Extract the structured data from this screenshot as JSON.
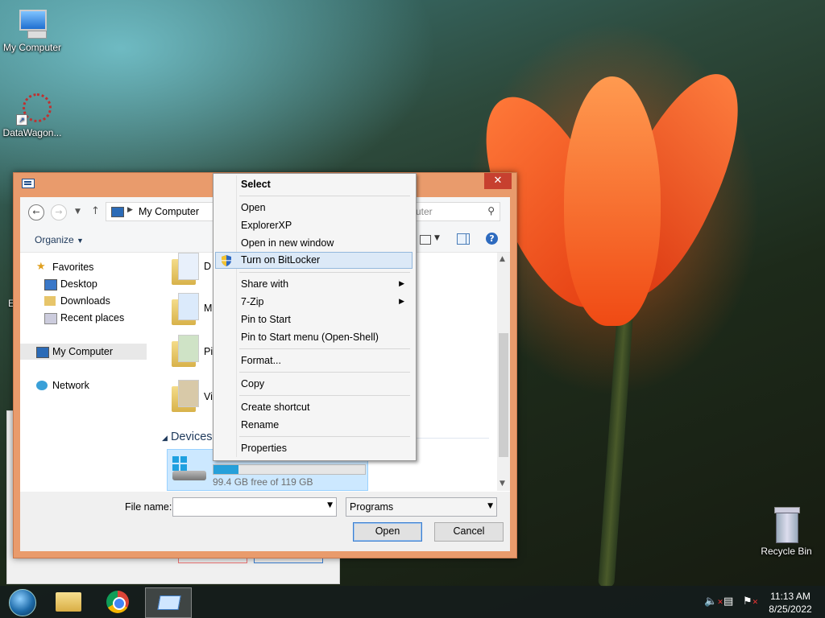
{
  "desktop": {
    "icons": [
      {
        "label": "My Computer"
      },
      {
        "label": "DataWagon..."
      },
      {
        "label": "Recycle Bin"
      }
    ],
    "edge_letter": "E"
  },
  "dialog": {
    "address": {
      "location": "My Computer"
    },
    "search": {
      "placeholder": "uter"
    },
    "toolbar": {
      "organize": "Organize"
    },
    "nav": {
      "favorites": "Favorites",
      "desktop": "Desktop",
      "downloads": "Downloads",
      "recent": "Recent places",
      "my_computer": "My Computer",
      "network": "Network"
    },
    "folders": [
      {
        "label": "D"
      },
      {
        "label": "M"
      },
      {
        "label": "Pi"
      },
      {
        "label": "Vi"
      }
    ],
    "devices_header": "Devices a",
    "drive": {
      "label": "Lo",
      "free_text": "99.4 GB free of 119 GB",
      "used_fraction": 0.165
    },
    "file_name_label": "File name:",
    "file_name_value": "",
    "file_type": "Programs",
    "open_label": "Open",
    "cancel_label": "Cancel"
  },
  "context_menu": {
    "header": "Select",
    "items": [
      {
        "label": "Open"
      },
      {
        "label": "ExplorerXP"
      },
      {
        "label": "Open in new window"
      },
      {
        "label": "Turn on BitLocker",
        "highlighted": true
      },
      {
        "label": "Share with",
        "submenu": true
      },
      {
        "label": "7-Zip",
        "submenu": true
      },
      {
        "label": "Pin to Start"
      },
      {
        "label": "Pin to Start menu (Open-Shell)"
      },
      {
        "label": "Format..."
      },
      {
        "label": "Copy"
      },
      {
        "label": "Create shortcut"
      },
      {
        "label": "Rename"
      },
      {
        "label": "Properties"
      }
    ]
  },
  "taskbar": {
    "clock": {
      "time": "11:13 AM",
      "date": "8/25/2022"
    }
  },
  "colors": {
    "accent": "#e99b6c",
    "selection": "#cce8ff",
    "highlight": "#dce9f7"
  }
}
